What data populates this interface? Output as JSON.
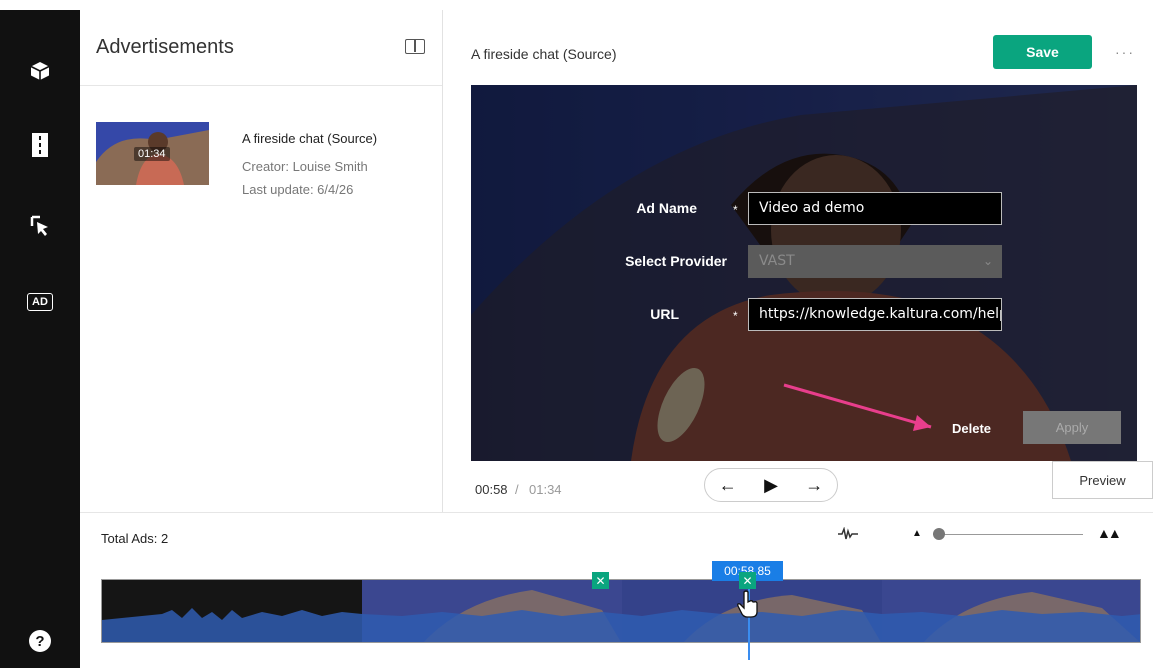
{
  "rail": {
    "ad_badge": "AD",
    "help_glyph": "?",
    "icons": [
      "cube-icon",
      "filmstrip-icon",
      "cursor-icon",
      "ad-icon",
      "help-icon"
    ]
  },
  "sidebar": {
    "title": "Advertisements",
    "entry": {
      "thumb_duration": "01:34",
      "name": "A fireside chat (Source)",
      "creator": "Creator: Louise Smith",
      "last_update": "Last update: 6/4/26"
    }
  },
  "editor": {
    "title": "A fireside chat (Source)",
    "save_label": "Save",
    "more_label": "···",
    "form": {
      "ad_name_label": "Ad Name",
      "ad_name_value": "Video ad demo",
      "provider_label": "Select Provider",
      "provider_value": "VAST",
      "url_label": "URL",
      "url_value": "https://knowledge.kaltura.com/help",
      "required_mark": "*",
      "delete_label": "Delete",
      "apply_label": "Apply"
    },
    "time_current": "00:58",
    "time_separator": "/",
    "time_total": "01:34",
    "preview_label": "Preview"
  },
  "timeline": {
    "total_ads": "Total Ads: 2",
    "playhead_time": "00:58.85",
    "marker_glyph": "✕"
  },
  "colors": {
    "accent": "#0aa57f",
    "rail": "#111111",
    "playhead": "#1a7ee6",
    "annotation_arrow": "#e83e8c"
  }
}
